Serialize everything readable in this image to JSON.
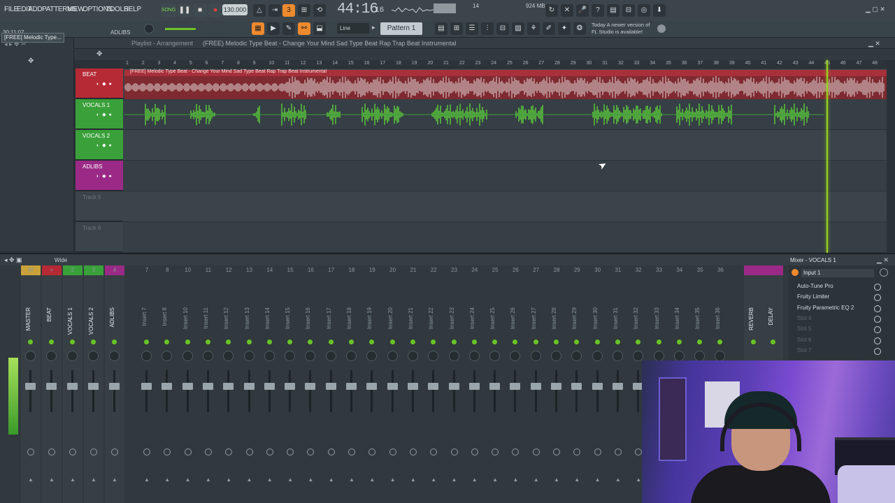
{
  "menu": [
    "FILE",
    "EDIT",
    "ADD",
    "PATTERNS",
    "VIEW",
    "OPTIONS",
    "TOOLS",
    "HELP"
  ],
  "transport": {
    "song_label": "SONG",
    "tempo": "130.000",
    "time_main": "44:16",
    "time_sub": "16",
    "cpu": "14",
    "mem": "924 MB",
    "mem_sub": "1"
  },
  "toolbar2": {
    "hint_time": "30:11:07",
    "hint_label": "ADLIBS",
    "snap": "Line",
    "pattern": "Pattern 1",
    "news_line1": "Today  A newer version of",
    "news_line2": "FL Studio is available!"
  },
  "browser": {
    "item": "[FREE] Melodic Type..."
  },
  "playlist": {
    "title": "Playlist - Arrangement",
    "song": "(FREE) Melodic Type Beat - Change Your Mind  Sad Type Beat  Rap Trap Beat Instrumental",
    "clip_label": "[FREE] Melodic Type Beat - Change Your Mind  Sad Type Beat  Rap Trap Beat Instrumental",
    "ruler": [
      "1",
      "2",
      "3",
      "4",
      "5",
      "6",
      "7",
      "8",
      "9",
      "10",
      "11",
      "12",
      "13",
      "14",
      "15",
      "16",
      "17",
      "18",
      "19",
      "20",
      "21",
      "22",
      "23",
      "24",
      "25",
      "26",
      "27",
      "28",
      "29",
      "30",
      "31",
      "32",
      "33",
      "34",
      "35",
      "36",
      "37",
      "38",
      "39",
      "40",
      "41",
      "42",
      "43",
      "44",
      "45",
      "46",
      "47",
      "48"
    ],
    "tracks": [
      {
        "name": "BEAT",
        "color": "#b52a35"
      },
      {
        "name": "VOCALS 1",
        "color": "#3aa03a"
      },
      {
        "name": "VOCALS 2",
        "color": "#3aa03a"
      },
      {
        "name": "ADLIBS",
        "color": "#9a2a86"
      },
      {
        "name": "Track 5",
        "color": "#3a444a"
      },
      {
        "name": "Track 6",
        "color": "#3a444a"
      }
    ]
  },
  "mixer": {
    "mode": "Wide",
    "title": "Mixer - VOCALS 1",
    "input": "Input 1",
    "strips": [
      {
        "num": "M",
        "label": "MASTER",
        "color": "#c9a23a"
      },
      {
        "num": "+",
        "label": "BEAT",
        "color": "#b52a35"
      },
      {
        "num": "2",
        "label": "VOCALS 1",
        "color": "#3aa03a"
      },
      {
        "num": "3",
        "label": "VOCALS 2",
        "color": "#3aa03a"
      },
      {
        "num": "4",
        "label": "ADLIBS",
        "color": "#9a2a86"
      },
      {
        "num": "7",
        "label": "Insert 7",
        "color": ""
      },
      {
        "num": "8",
        "label": "Insert 8",
        "color": ""
      },
      {
        "num": "10",
        "label": "Insert 10",
        "color": ""
      },
      {
        "num": "11",
        "label": "Insert 11",
        "color": ""
      },
      {
        "num": "12",
        "label": "Insert 12",
        "color": ""
      },
      {
        "num": "13",
        "label": "Insert 13",
        "color": ""
      },
      {
        "num": "14",
        "label": "Insert 14",
        "color": ""
      },
      {
        "num": "15",
        "label": "Insert 15",
        "color": ""
      },
      {
        "num": "16",
        "label": "Insert 16",
        "color": ""
      },
      {
        "num": "17",
        "label": "Insert 17",
        "color": ""
      },
      {
        "num": "18",
        "label": "Insert 18",
        "color": ""
      },
      {
        "num": "19",
        "label": "Insert 19",
        "color": ""
      },
      {
        "num": "20",
        "label": "Insert 20",
        "color": ""
      },
      {
        "num": "21",
        "label": "Insert 21",
        "color": ""
      },
      {
        "num": "22",
        "label": "Insert 22",
        "color": ""
      },
      {
        "num": "23",
        "label": "Insert 23",
        "color": ""
      },
      {
        "num": "24",
        "label": "Insert 24",
        "color": ""
      },
      {
        "num": "25",
        "label": "Insert 25",
        "color": ""
      },
      {
        "num": "26",
        "label": "Insert 26",
        "color": ""
      },
      {
        "num": "27",
        "label": "Insert 27",
        "color": ""
      },
      {
        "num": "28",
        "label": "Insert 28",
        "color": ""
      },
      {
        "num": "29",
        "label": "Insert 29",
        "color": ""
      },
      {
        "num": "30",
        "label": "Insert 30",
        "color": ""
      },
      {
        "num": "31",
        "label": "Insert 31",
        "color": ""
      },
      {
        "num": "32",
        "label": "Insert 32",
        "color": ""
      },
      {
        "num": "33",
        "label": "Insert 33",
        "color": ""
      },
      {
        "num": "34",
        "label": "Insert 34",
        "color": ""
      },
      {
        "num": "35",
        "label": "Insert 35",
        "color": ""
      },
      {
        "num": "36",
        "label": "Insert 36",
        "color": ""
      }
    ],
    "sends": [
      {
        "label": "REVERB",
        "color": "#9a2a86"
      },
      {
        "label": "DELAY",
        "color": "#9a2a86"
      }
    ],
    "fx_slots": [
      {
        "name": "Auto-Tune Pro",
        "empty": false
      },
      {
        "name": "Fruity Limiter",
        "empty": false
      },
      {
        "name": "Fruity Parametric EQ 2",
        "empty": false
      },
      {
        "name": "Slot 4",
        "empty": true
      },
      {
        "name": "Slot 5",
        "empty": true
      },
      {
        "name": "Slot 6",
        "empty": true
      },
      {
        "name": "Slot 7",
        "empty": true
      }
    ]
  },
  "colors": {
    "accent": "#ee8a2e",
    "playhead": "#9ad21e",
    "beat": "#b52a35",
    "vocals": "#3aa03a",
    "adlibs": "#9a2a86"
  },
  "icons": [
    "pause-icon",
    "stop-icon",
    "record-icon",
    "metronome-icon",
    "cursor-icon",
    "webcam-overlay"
  ]
}
